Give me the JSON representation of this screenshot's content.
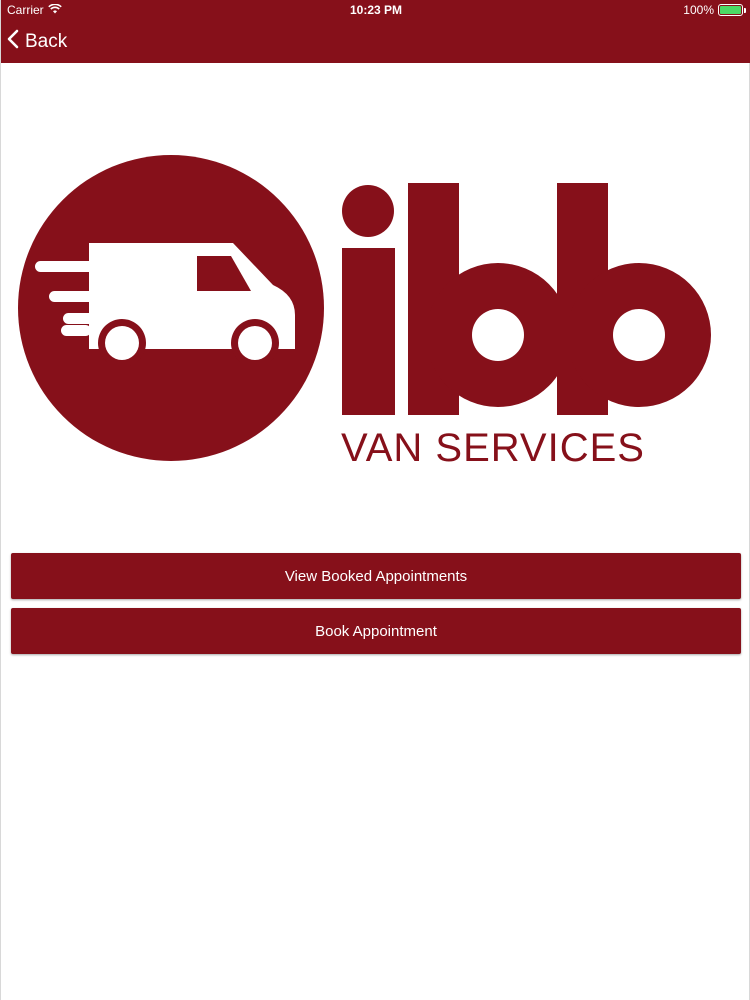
{
  "status_bar": {
    "carrier": "Carrier",
    "time": "10:23 PM",
    "battery": "100%",
    "battery_level": 1.0
  },
  "nav": {
    "back_label": "Back"
  },
  "logo": {
    "wordmark": "ibb",
    "tagline": "VAN SERVICES",
    "icon": "van-icon"
  },
  "actions": {
    "view_booked_label": "View Booked Appointments",
    "book_label": "Book Appointment"
  },
  "colors": {
    "brand": "#86101a",
    "battery": "#4cd964",
    "text_on_brand": "#ffffff"
  }
}
